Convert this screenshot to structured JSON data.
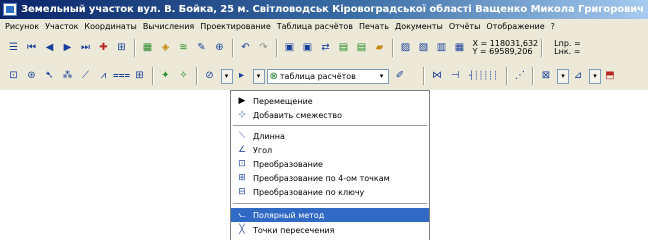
{
  "window": {
    "title": "Земельный участок     вул. В. Бойка, 25 м. Світловодськ Кіровоградської області     Ващенко Микола Григорович"
  },
  "menubar": {
    "items": [
      "Рисунок",
      "Участок",
      "Координаты",
      "Вычисления",
      "Проектирование",
      "Таблица расчётов",
      "Печать",
      "Документы",
      "Отчёты",
      "Отображение",
      "?"
    ]
  },
  "toolbar": {
    "coord_x": "X = 118031,632",
    "coord_y": "Y = 69589,206",
    "lnp": "Lпр. =",
    "lnk": "Lнк. =",
    "table_select": "таблица расчётов"
  },
  "dropdown": {
    "items": [
      {
        "label": "Перемещение",
        "icon": "arrow-pointer-icon"
      },
      {
        "label": "Добавить смежество",
        "icon": "add-adjacency-icon"
      },
      {
        "label": "Длинна",
        "icon": "length-icon"
      },
      {
        "label": "Угол",
        "icon": "angle-icon"
      },
      {
        "label": "Преобразование",
        "icon": "transform-icon"
      },
      {
        "label": "Преобразование по 4-ом точкам",
        "icon": "transform-4-points-icon"
      },
      {
        "label": "Преобразование по ключу",
        "icon": "transform-key-icon"
      },
      {
        "label": "Полярный метод",
        "icon": "polar-method-icon"
      },
      {
        "label": "Точки пересечения",
        "icon": "intersection-points-icon"
      }
    ],
    "selected_index": 7,
    "selection_color": "#316ac5"
  }
}
